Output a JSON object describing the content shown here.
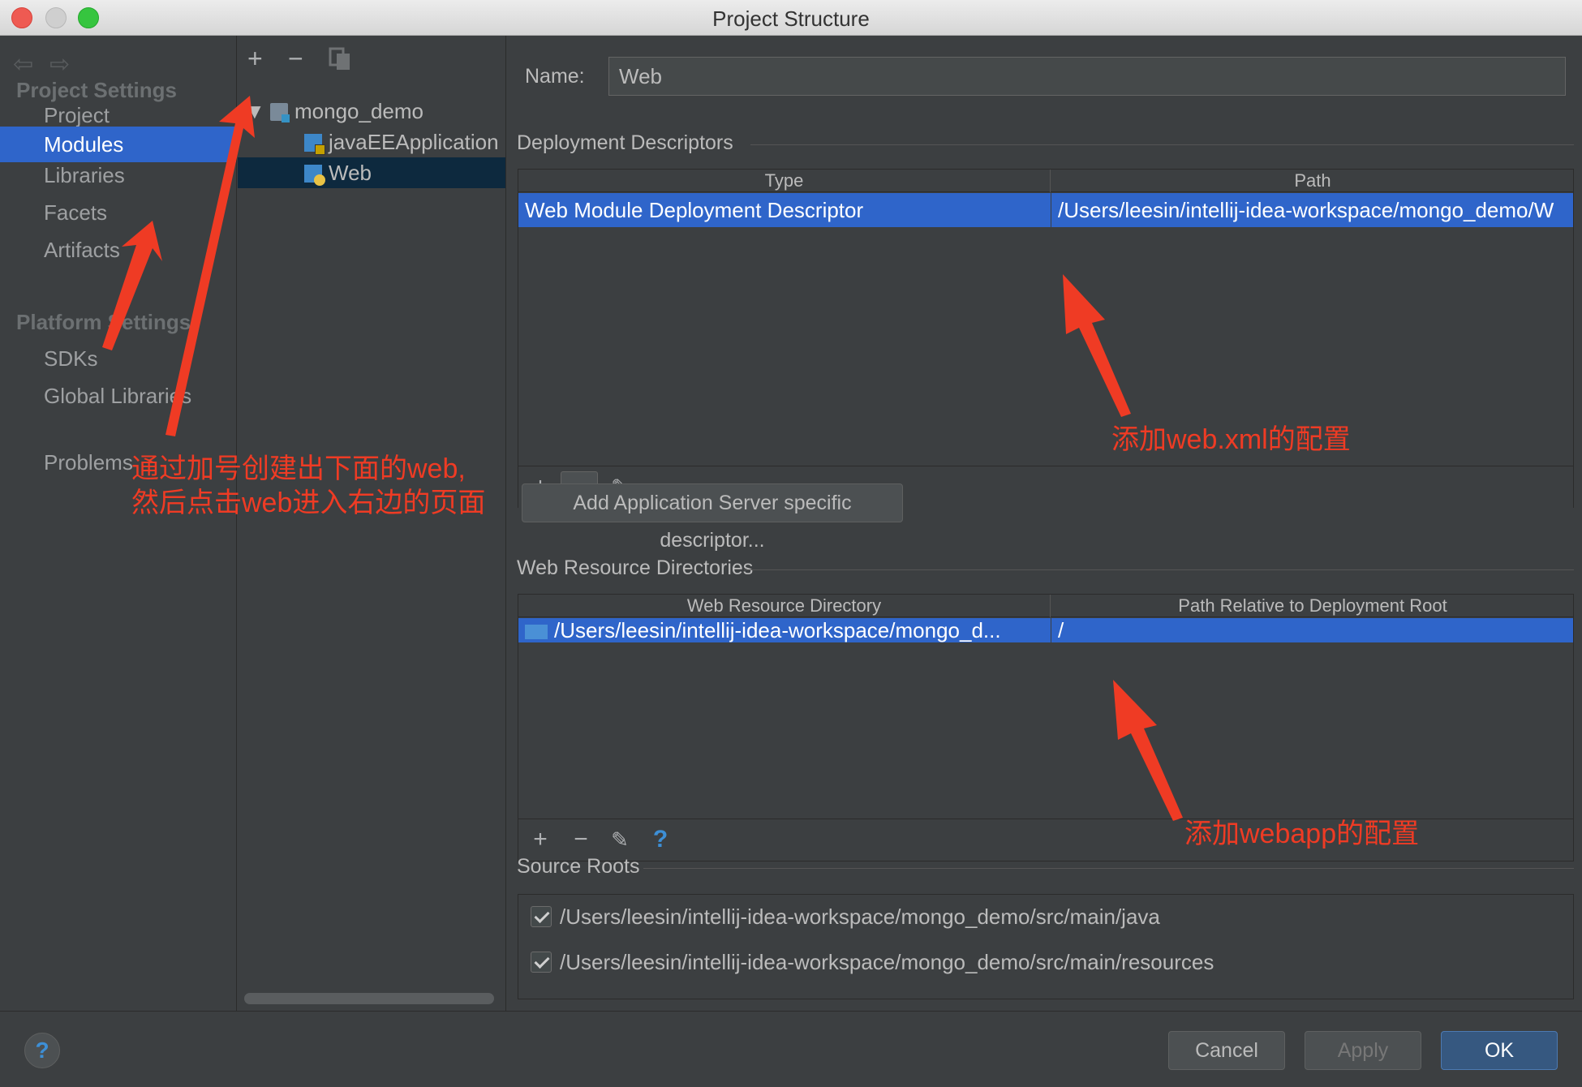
{
  "window": {
    "title": "Project Structure"
  },
  "sidebar": {
    "sections": [
      {
        "title": "Project Settings",
        "items": [
          "Project",
          "Modules",
          "Libraries",
          "Facets",
          "Artifacts"
        ]
      },
      {
        "title": "Platform Settings",
        "items": [
          "SDKs",
          "Global Libraries"
        ]
      }
    ],
    "problems": "Problems",
    "selected": "Modules"
  },
  "modules": {
    "toolbar": {
      "add": "+",
      "remove": "−",
      "copy": "copy-icon"
    },
    "tree": [
      {
        "label": "mongo_demo",
        "level": 0,
        "icon": "folder-icon",
        "expanded": true
      },
      {
        "label": "javaEEApplication",
        "level": 1,
        "icon": "module-icon"
      },
      {
        "label": "Web",
        "level": 1,
        "icon": "web-module-icon",
        "selected": true
      }
    ]
  },
  "main": {
    "name_label": "Name:",
    "name_value": "Web",
    "deployment": {
      "title": "Deployment Descriptors",
      "columns": [
        "Type",
        "Path"
      ],
      "rows": [
        {
          "type": "Web Module Deployment Descriptor",
          "path": "/Users/leesin/intellij-idea-workspace/mongo_demo/W"
        }
      ]
    },
    "add_server_button": "Add Application Server specific descriptor...",
    "web_resources": {
      "title": "Web Resource Directories",
      "columns": [
        "Web Resource Directory",
        "Path Relative to Deployment Root"
      ],
      "rows": [
        {
          "dir": "/Users/leesin/intellij-idea-workspace/mongo_d...",
          "rel": "/"
        }
      ]
    },
    "source_roots": {
      "title": "Source Roots",
      "items": [
        "/Users/leesin/intellij-idea-workspace/mongo_demo/src/main/java",
        "/Users/leesin/intellij-idea-workspace/mongo_demo/src/main/resources"
      ]
    }
  },
  "tabletool": {
    "add": "+",
    "remove": "−",
    "edit": "✎",
    "help": "?"
  },
  "buttons": {
    "help": "?",
    "cancel": "Cancel",
    "apply": "Apply",
    "ok": "OK"
  },
  "annotations": {
    "left_line1": "通过加号创建出下面的web,",
    "left_line2": "然后点击web进入右边的页面",
    "webxml": "添加web.xml的配置",
    "webapp": "添加webapp的配置"
  },
  "colors": {
    "selection": "#2f65ca",
    "annotation": "#ef3b24",
    "background": "#3c3f41"
  }
}
